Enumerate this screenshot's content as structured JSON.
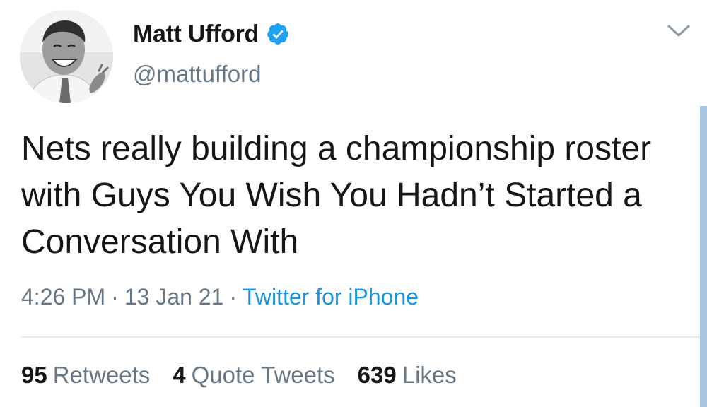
{
  "user": {
    "display_name": "Matt Ufford",
    "handle": "@mattufford",
    "verified": true
  },
  "tweet": {
    "text": "Nets really building a championship roster with Guys You Wish You Hadn’t Started a Conversation With",
    "time": "4:26 PM",
    "date": "13 Jan 21",
    "separator": "·",
    "source": "Twitter for iPhone"
  },
  "stats": {
    "retweets": {
      "count": "95",
      "label": "Retweets"
    },
    "quote_tweets": {
      "count": "4",
      "label": "Quote Tweets"
    },
    "likes": {
      "count": "639",
      "label": "Likes"
    }
  },
  "colors": {
    "verified_badge": "#1da1f2",
    "link": "#1b95e0",
    "secondary_text": "#657786",
    "divider": "#e6ecf0"
  },
  "icons": {
    "verified": "verified-badge-icon",
    "caret": "chevron-down-icon"
  }
}
